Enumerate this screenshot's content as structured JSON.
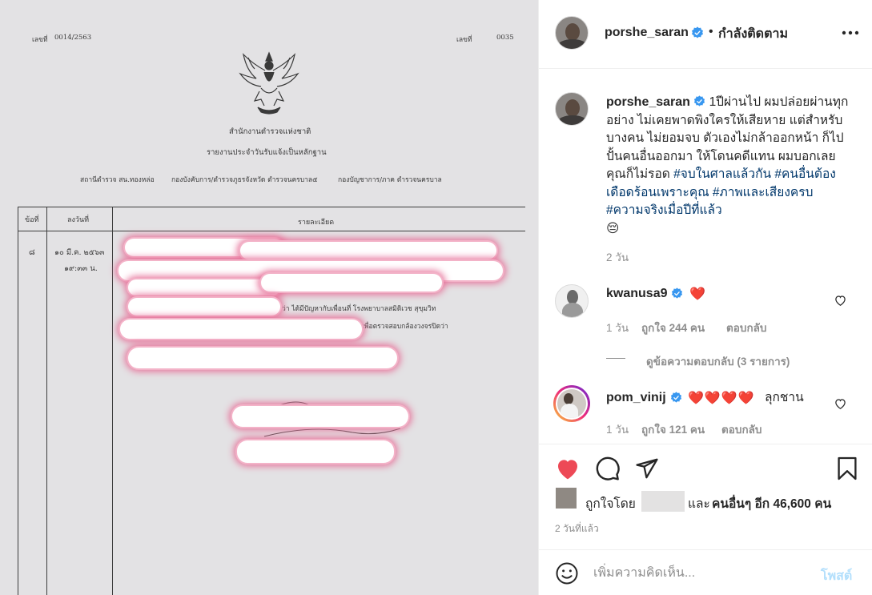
{
  "document": {
    "doc_no_label": "เลขที่",
    "doc_no_value": "0014/2563",
    "page_label": "เลขที่",
    "page_value": "0035",
    "agency": "สำนักงานตำรวจแห่งชาติ",
    "report_title": "รายงานประจำวันรับแจ้งเป็นหลักฐาน",
    "station": "สถานีตำรวจ สน.ทองหล่อ",
    "division": "กองบังคับการ/ตำรวจภูธรจังหวัด ตำรวจนครบาล๕",
    "bureau": "กองบัญชาการ/ภาค ตำรวจนครบาล",
    "col_item": "ข้อที่",
    "col_date": "ลงวันที่",
    "col_detail": "รายละเอียด",
    "item_no": "๘",
    "date_line1": "๑๐ มี.ค. ๒๕๖๓",
    "date_line2": "๑๙:๓๓ น.",
    "visible_fragment1": "ว่า ได้มีปัญหากับเพื่อนที่ โรงพยาบาลสมิติเวช สุขุมวิท",
    "visible_fragment2": "เพื่อตรวจสอบกล้องวงจรปิดว่า"
  },
  "header": {
    "username": "porshe_saran",
    "separator": "•",
    "follow_status": "กำลังติดตาม",
    "more_icon": "more-horizontal-icon"
  },
  "caption": {
    "username": "porshe_saran",
    "text": "1ปีผ่านไป ผมปล่อยผ่านทุกอย่าง ไม่เคยพาดพิงใครให้เสียหาย แต่สำหรับบางคน ไม่ยอมจบ ตัวเองไม่กล้าออกหน้า ก็ไปปั้นคนอื่นออกมา ให้โดนคดีแทน ผมบอกเลยคุณก็ไม่รอด",
    "hashtags": [
      "#จบในศาลแล้วกัน",
      "#คนอื่นต้องเดือดร้อนเพราะคุณ",
      "#ภาพและเสียงครบ",
      "#ความจริงเมื่อปีที่แล้ว"
    ],
    "emoji": "😔",
    "time": "2 วัน"
  },
  "comments": [
    {
      "username": "kwanusa9",
      "text": "❤️",
      "time": "1 วัน",
      "likes": "ถูกใจ 244 คน",
      "reply": "ตอบกลับ",
      "view_replies": "ดูข้อความตอบกลับ (3 รายการ)"
    },
    {
      "username": "pom_vinij",
      "hearts": "❤️❤️❤️❤️",
      "text": "ลุกชาน",
      "time": "1 วัน",
      "likes": "ถูกใจ 121 คน",
      "reply": "ตอบกลับ"
    }
  ],
  "actions": {
    "liked_by_prefix": "ถูกใจโดย",
    "liked_by_and": "และ",
    "liked_by_others": "คนอื่นๆ อีก 46,600 คน",
    "posted_time": "2 วันที่แล้ว"
  },
  "comment_input": {
    "placeholder": "เพิ่มความคิดเห็น...",
    "post_button": "โพสต์"
  },
  "colors": {
    "heart_red": "#ed4956",
    "verified_blue": "#3897f0",
    "link_blue": "#00376b",
    "muted_gray": "#8e8e8e",
    "post_button_disabled": "#b2dffc",
    "redaction_pink": "#e7729a"
  }
}
